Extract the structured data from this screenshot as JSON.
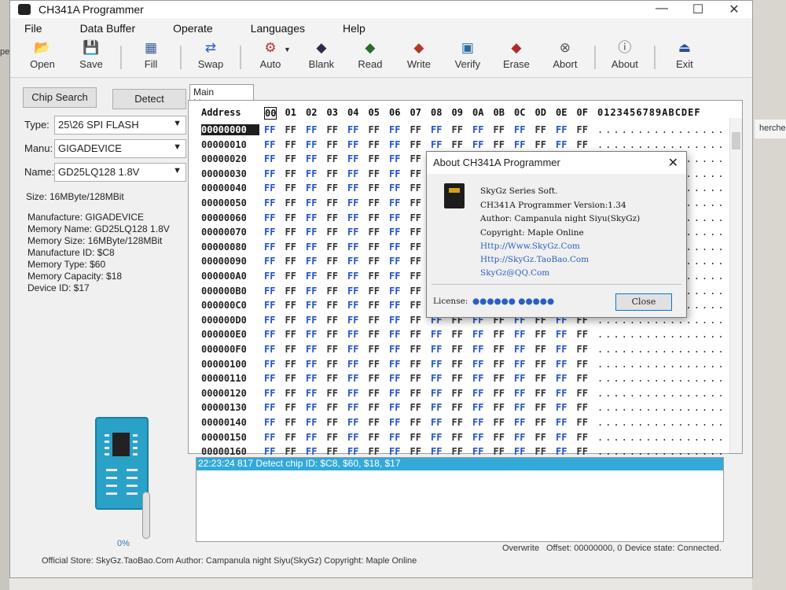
{
  "window": {
    "title": "CH341A Programmer",
    "controls": [
      "—",
      "☐",
      "✕"
    ]
  },
  "background": {
    "left_fragment": "pe",
    "right_fragment": "hercher da"
  },
  "menu": [
    "File",
    "Data Buffer",
    "Operate",
    "Languages",
    "Help"
  ],
  "toolbar": [
    {
      "label": "Open",
      "icon": "folder-open-icon",
      "glyph": "📂"
    },
    {
      "label": "Save",
      "icon": "save-icon",
      "glyph": "💾"
    },
    {
      "label": "Fill",
      "icon": "fill-icon",
      "glyph": "▦"
    },
    {
      "label": "Swap",
      "icon": "swap-icon",
      "glyph": "⇄"
    },
    {
      "label": "Auto",
      "icon": "auto-icon",
      "glyph": "⚙"
    },
    {
      "label": "Blank",
      "icon": "blank-icon",
      "glyph": "◆"
    },
    {
      "label": "Read",
      "icon": "read-icon",
      "glyph": "◆"
    },
    {
      "label": "Write",
      "icon": "write-icon",
      "glyph": "◆"
    },
    {
      "label": "Verify",
      "icon": "verify-icon",
      "glyph": "▣"
    },
    {
      "label": "Erase",
      "icon": "erase-icon",
      "glyph": "◆"
    },
    {
      "label": "Abort",
      "icon": "abort-icon",
      "glyph": "⊗"
    },
    {
      "label": "About",
      "icon": "about-icon",
      "glyph": "ⓘ"
    },
    {
      "label": "Exit",
      "icon": "exit-icon",
      "glyph": "⏏"
    }
  ],
  "left": {
    "chip_search": "Chip Search",
    "detect": "Detect",
    "type_label": "Type:",
    "type_value": "25\\26 SPI FLASH",
    "manu_label": "Manu:",
    "manu_value": "GIGADEVICE",
    "name_label": "Name:",
    "name_value": "GD25LQ128 1.8V",
    "size_line": "Size:   16MByte/128MBit",
    "info": [
      "Manufacture: GIGADEVICE",
      "Memory Name: GD25LQ128 1.8V",
      "Memory Size: 16MByte/128MBit",
      "Manufacture ID: $C8",
      "Memory Type: $60",
      "Memory Capacity: $18",
      "Device ID: $17"
    ],
    "progress_percent": "0%"
  },
  "hex": {
    "tab": "Main Memory",
    "header_address": "Address",
    "columns": [
      "00",
      "01",
      "02",
      "03",
      "04",
      "05",
      "06",
      "07",
      "08",
      "09",
      "0A",
      "0B",
      "0C",
      "0D",
      "0E",
      "0F"
    ],
    "ascii_header": "0123456789ABCDEF",
    "addresses": [
      "00000000",
      "00000010",
      "00000020",
      "00000030",
      "00000040",
      "00000050",
      "00000060",
      "00000070",
      "00000080",
      "00000090",
      "000000A0",
      "000000B0",
      "000000C0",
      "000000D0",
      "000000E0",
      "000000F0",
      "00000100",
      "00000110",
      "00000120",
      "00000130",
      "00000140",
      "00000150",
      "00000160"
    ],
    "byte": "FF",
    "ascii_row": "................"
  },
  "log": {
    "lines": [
      "22:23:24 817 Detect chip ID: $C8, $60, $18, $17"
    ]
  },
  "status": {
    "mode": "Overwrite",
    "offset": "Offset: 00000000, 0",
    "device_state": "Device state: Connected."
  },
  "footer": "Official Store: SkyGz.TaoBao.Com Author: Campanula night Siyu(SkyGz) Copyright: Maple Online",
  "about": {
    "title": "About CH341A Programmer",
    "close_x": "✕",
    "lines": [
      "SkyGz Series Soft.",
      "CH341A Programmer Version:1.34",
      "Author: Campanula night Siyu(SkyGz)",
      "Copyright: Maple Online"
    ],
    "links": [
      "Http://Www.SkyGz.Com",
      "Http://SkyGz.TaoBao.Com",
      "SkyGz@QQ.Com"
    ],
    "license_label": "License:",
    "license_value": "●●●●●● ●●●●●",
    "close_button": "Close"
  },
  "colors": {
    "hex_byte": "#2354c4",
    "log_highlight": "#33a9d8",
    "link": "#2b5fc1"
  }
}
